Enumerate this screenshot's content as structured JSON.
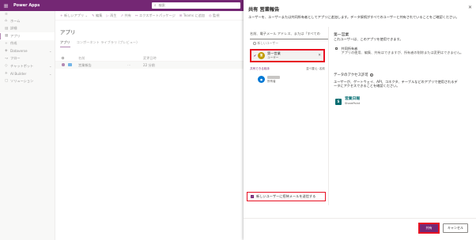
{
  "topbar": {
    "app_name": "Power Apps",
    "search_placeholder": "検索"
  },
  "sidebar": {
    "items": [
      {
        "icon": "home-icon",
        "glyph": "⌂",
        "label": "ホーム"
      },
      {
        "icon": "book-icon",
        "glyph": "▤",
        "label": "詳細"
      },
      {
        "icon": "apps-icon",
        "glyph": "▦",
        "label": "アプリ",
        "active": true
      },
      {
        "icon": "plus-icon",
        "glyph": "+",
        "label": "作成"
      },
      {
        "icon": "dataverse-icon",
        "glyph": "◈",
        "label": "Dataverse",
        "chevron": "⌄"
      },
      {
        "icon": "flow-icon",
        "glyph": "↝",
        "label": "フロー"
      },
      {
        "icon": "chatbot-icon",
        "glyph": "◇",
        "label": "チャットボット",
        "chevron": "⌄"
      },
      {
        "icon": "ai-builder-icon",
        "glyph": "✳",
        "label": "AI Builder",
        "chevron": "⌄"
      },
      {
        "icon": "solutions-icon",
        "glyph": "▢",
        "label": "ソリューション"
      }
    ]
  },
  "commandbar": {
    "items": [
      {
        "icon": "plus-icon",
        "glyph": "+",
        "label": "新しいアプリ ⌄"
      },
      {
        "icon": "edit-icon",
        "glyph": "✎",
        "label": "編集"
      },
      {
        "icon": "play-icon",
        "glyph": "▷",
        "label": "再生"
      },
      {
        "icon": "share-icon",
        "glyph": "⇗",
        "label": "共有"
      },
      {
        "icon": "export-icon",
        "glyph": "↦",
        "label": "エクスポートパッケージ"
      },
      {
        "icon": "teams-icon",
        "glyph": "⊞",
        "label": "Teams に追加"
      },
      {
        "icon": "monitor-icon",
        "glyph": "◎",
        "label": "監視"
      }
    ]
  },
  "main": {
    "title": "アプリ",
    "tabs": [
      "アプリ",
      "コンポーネント ライブラリ (プレビュー)"
    ],
    "columns": {
      "name": "名前",
      "modified": "変更日時"
    },
    "rows": [
      {
        "name": "営業報告",
        "modified": "22 分前"
      }
    ]
  },
  "panel": {
    "title": "共有 営業報告",
    "close": "✕",
    "description": "ユーザーを、ユーザーまたは共同所有者としてアプリに追加します。データ接続がすべてのユーザーと共有されていることをご確認ください。",
    "people_picker_placeholder": "名前、電子メール アドレス、または「すべての",
    "new_user_label": "新しいユーザー",
    "selected_user": {
      "initial": "第",
      "name": "第一営業",
      "role": "ユーザー"
    },
    "suggested_header": "共有できる相手",
    "sort_label": "並べ替え: 名前",
    "suggested_user": {
      "role": "所有者"
    },
    "email_option": "新しいユーザーに招待メールを送信する",
    "right": {
      "title": "第一営業",
      "description": "これユーザーは、このアプリを使用できます。",
      "owner_label": "共同所有者",
      "owner_description": "アプリの使用、編集、共有はできますが、所有者の削除または変更はできません。",
      "data_title": "データのアクセス許可",
      "data_description": "ユーザーが、ゲートウェイ、API、コネクタ、テーブルなどのアプリで使用されるデータにアクセスできることを確認ください。",
      "datasource": {
        "name": "営業日報",
        "type": "SharePoint",
        "initial": "S"
      }
    },
    "buttons": {
      "share": "共有",
      "cancel": "キャンセル"
    }
  },
  "colors": {
    "brand": "#742774",
    "highlight": "#e81123"
  }
}
